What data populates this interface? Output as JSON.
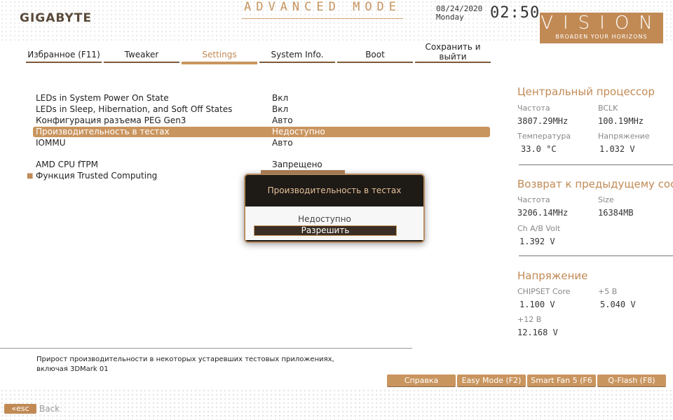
{
  "header": {
    "logo": "GIGABYTE",
    "mode": "ADVANCED MODE",
    "date": "08/24/2020",
    "weekday": "Monday",
    "time": "02:50",
    "brand": "VISION",
    "brand_tagline": "BROADEN YOUR HORIZONS"
  },
  "tabs": [
    {
      "label": "Избранное (F11)"
    },
    {
      "label": "Tweaker"
    },
    {
      "label": "Settings"
    },
    {
      "label": "System Info."
    },
    {
      "label": "Boot"
    },
    {
      "label": "Сохранить и выйти"
    }
  ],
  "settings": [
    {
      "label": "LEDs in System Power On State",
      "value": "Вкл"
    },
    {
      "label": "LEDs in Sleep, Hibernation, and Soft Off States",
      "value": "Вкл"
    },
    {
      "label": "Конфигурация разъема PEG Gen3",
      "value": "Авто"
    },
    {
      "label": "Производительность в тестах",
      "value": "Недоступно"
    },
    {
      "label": "IOMMU",
      "value": "Авто"
    },
    {
      "label": "AMD CPU fTPM",
      "value": "Запрещено"
    },
    {
      "label": "Функция Trusted Computing",
      "value": ""
    }
  ],
  "popup": {
    "title": "Производительность в тестах",
    "options": [
      "Недоступно",
      "Разрешить"
    ],
    "selected": "Разрешить"
  },
  "cpu": {
    "title": "Центральный процессор",
    "freq_label": "Частота",
    "freq": "3807.29MHz",
    "bclk_label": "BCLK",
    "bclk": "100.19MHz",
    "temp_label": "Температура",
    "temp": "33.0 °C",
    "volt_label": "Напряжение",
    "volt": "1.032 V"
  },
  "memory": {
    "title": "Возврат к предыдущему сост",
    "freq_label": "Частота",
    "freq": "3206.14MHz",
    "size_label": "Size",
    "size": "16384MB",
    "chab_label": "Ch A/B Volt",
    "chab": "1.392 V"
  },
  "voltage": {
    "title": "Напряжение",
    "chipset_label": "CHIPSET Core",
    "chipset": "1.100 V",
    "p5_label": "+5 В",
    "p5": "5.040 V",
    "p12_label": "+12 В",
    "p12": "12.168 V"
  },
  "help": {
    "line1": "Прирост производительности в некоторых устаревших тестовых приложениях,",
    "line2": "включая 3DMark 01"
  },
  "buttons": {
    "help": "Справка",
    "easy": "Easy Mode (F2)",
    "fan": "Smart Fan 5 (F6",
    "qflash": "Q-Flash (F8)"
  },
  "footer": {
    "esc": "esc",
    "back": "Back"
  }
}
